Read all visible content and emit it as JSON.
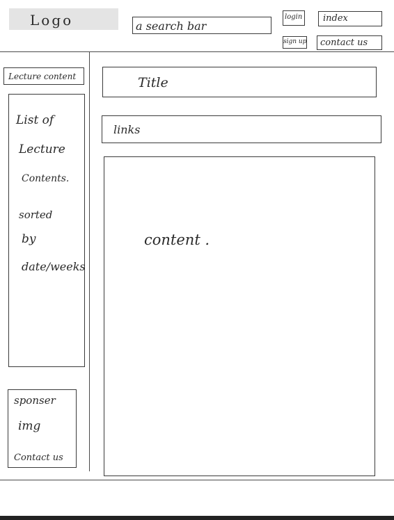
{
  "header": {
    "logo": "Logo",
    "search_placeholder": "a search bar",
    "login_label": "login",
    "index_label": "index",
    "signup_label": "sign up",
    "contact_label": "contact us"
  },
  "sidebar": {
    "section_title": "Lecture content",
    "list_lines": [
      "List of",
      "Lecture",
      "Contents.",
      "sorted",
      "by",
      "date/weeks"
    ],
    "sponsor_lines": [
      "sponser",
      "img",
      "Contact us"
    ]
  },
  "main": {
    "title_label": "Title",
    "links_label": "links",
    "content_label": "content ."
  }
}
